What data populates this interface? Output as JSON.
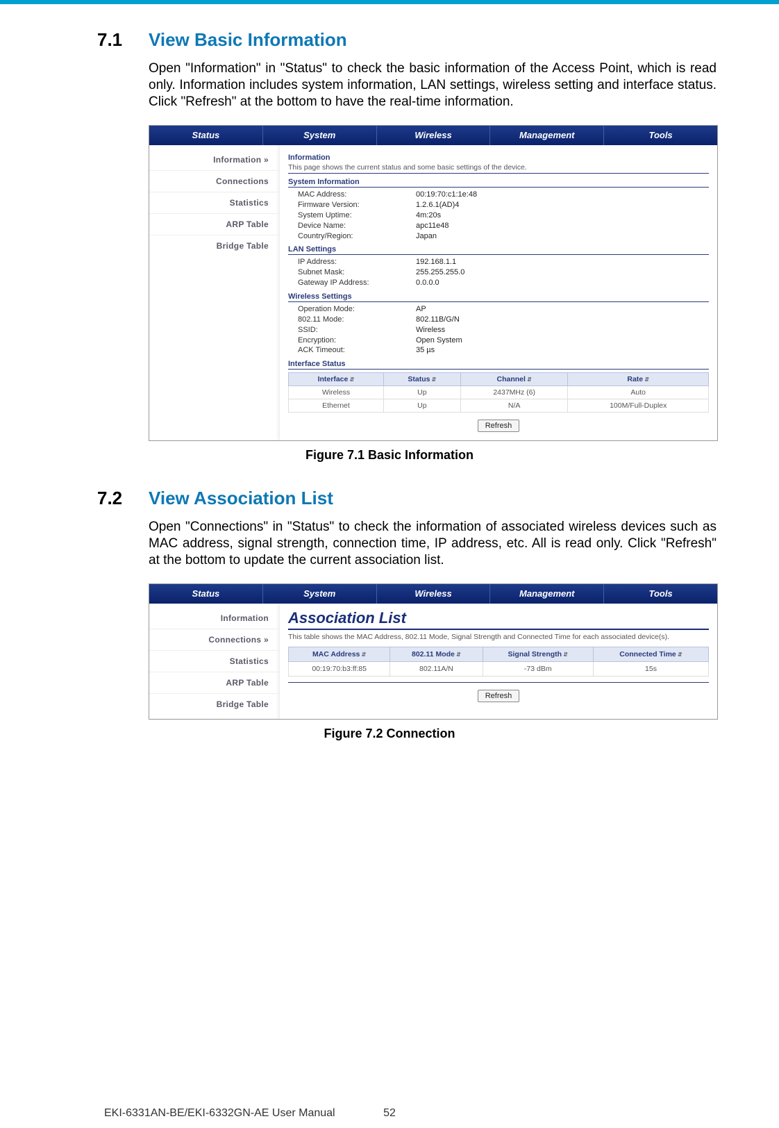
{
  "section1": {
    "num": "7.1",
    "title": "View Basic Information",
    "para": "Open \"Information\" in \"Status\" to check the basic information of the Access Point, which is read only. Information includes system information, LAN settings, wireless setting and interface status.  Click \"Refresh\" at the bottom to have the real-time information."
  },
  "section2": {
    "num": "7.2",
    "title": "View Association List",
    "para": "Open \"Connections\" in \"Status\" to check the information of associated wireless devices such as MAC address, signal strength, connection time, IP address, etc. All is read only. Click \"Refresh\" at the bottom to update the current association list."
  },
  "fig1_caption": "Figure 7.1 Basic Information",
  "fig2_caption": "Figure 7.2 Connection",
  "footer": {
    "manual": "EKI-6331AN-BE/EKI-6332GN-AE User Manual",
    "page": "52"
  },
  "nav": {
    "t0": "Status",
    "t1": "System",
    "t2": "Wireless",
    "t3": "Management",
    "t4": "Tools"
  },
  "sidebar": {
    "i0": "Information",
    "i1": "Connections",
    "i2": "Statistics",
    "i3": "ARP Table",
    "i4": "Bridge Table"
  },
  "shot1": {
    "heading": "Information",
    "desc": "This page shows the current status and some basic settings of the device.",
    "sys_head": "System Information",
    "sys": {
      "k0": "MAC Address:",
      "v0": "00:19:70:c1:1e:48",
      "k1": "Firmware Version:",
      "v1": "1.2.6.1(AD)4",
      "k2": "System Uptime:",
      "v2": "4m:20s",
      "k3": "Device Name:",
      "v3": "apc11e48",
      "k4": "Country/Region:",
      "v4": "Japan"
    },
    "lan_head": "LAN Settings",
    "lan": {
      "k0": "IP Address:",
      "v0": "192.168.1.1",
      "k1": "Subnet Mask:",
      "v1": "255.255.255.0",
      "k2": "Gateway IP Address:",
      "v2": "0.0.0.0"
    },
    "wl_head": "Wireless Settings",
    "wl": {
      "k0": "Operation Mode:",
      "v0": "AP",
      "k1": "802.11 Mode:",
      "v1": "802.11B/G/N",
      "k2": "SSID:",
      "v2": "Wireless",
      "k3": "Encryption:",
      "v3": "Open System",
      "k4": "ACK Timeout:",
      "v4": "35 µs"
    },
    "if_head": "Interface Status",
    "if_cols": {
      "c0": "Interface",
      "c1": "Status",
      "c2": "Channel",
      "c3": "Rate"
    },
    "if_rows": {
      "r0c0": "Wireless",
      "r0c1": "Up",
      "r0c2": "2437MHz (6)",
      "r0c3": "Auto",
      "r1c0": "Ethernet",
      "r1c1": "Up",
      "r1c2": "N/A",
      "r1c3": "100M/Full-Duplex"
    },
    "refresh": "Refresh"
  },
  "shot2": {
    "title": "Association List",
    "desc": "This table shows the MAC Address, 802.11 Mode, Signal Strength and Connected Time for each associated device(s).",
    "cols": {
      "c0": "MAC Address",
      "c1": "802.11 Mode",
      "c2": "Signal Strength",
      "c3": "Connected Time"
    },
    "row": {
      "c0": "00:19:70:b3:ff:85",
      "c1": "802.11A/N",
      "c2": "-73 dBm",
      "c3": "15s"
    },
    "refresh": "Refresh"
  }
}
